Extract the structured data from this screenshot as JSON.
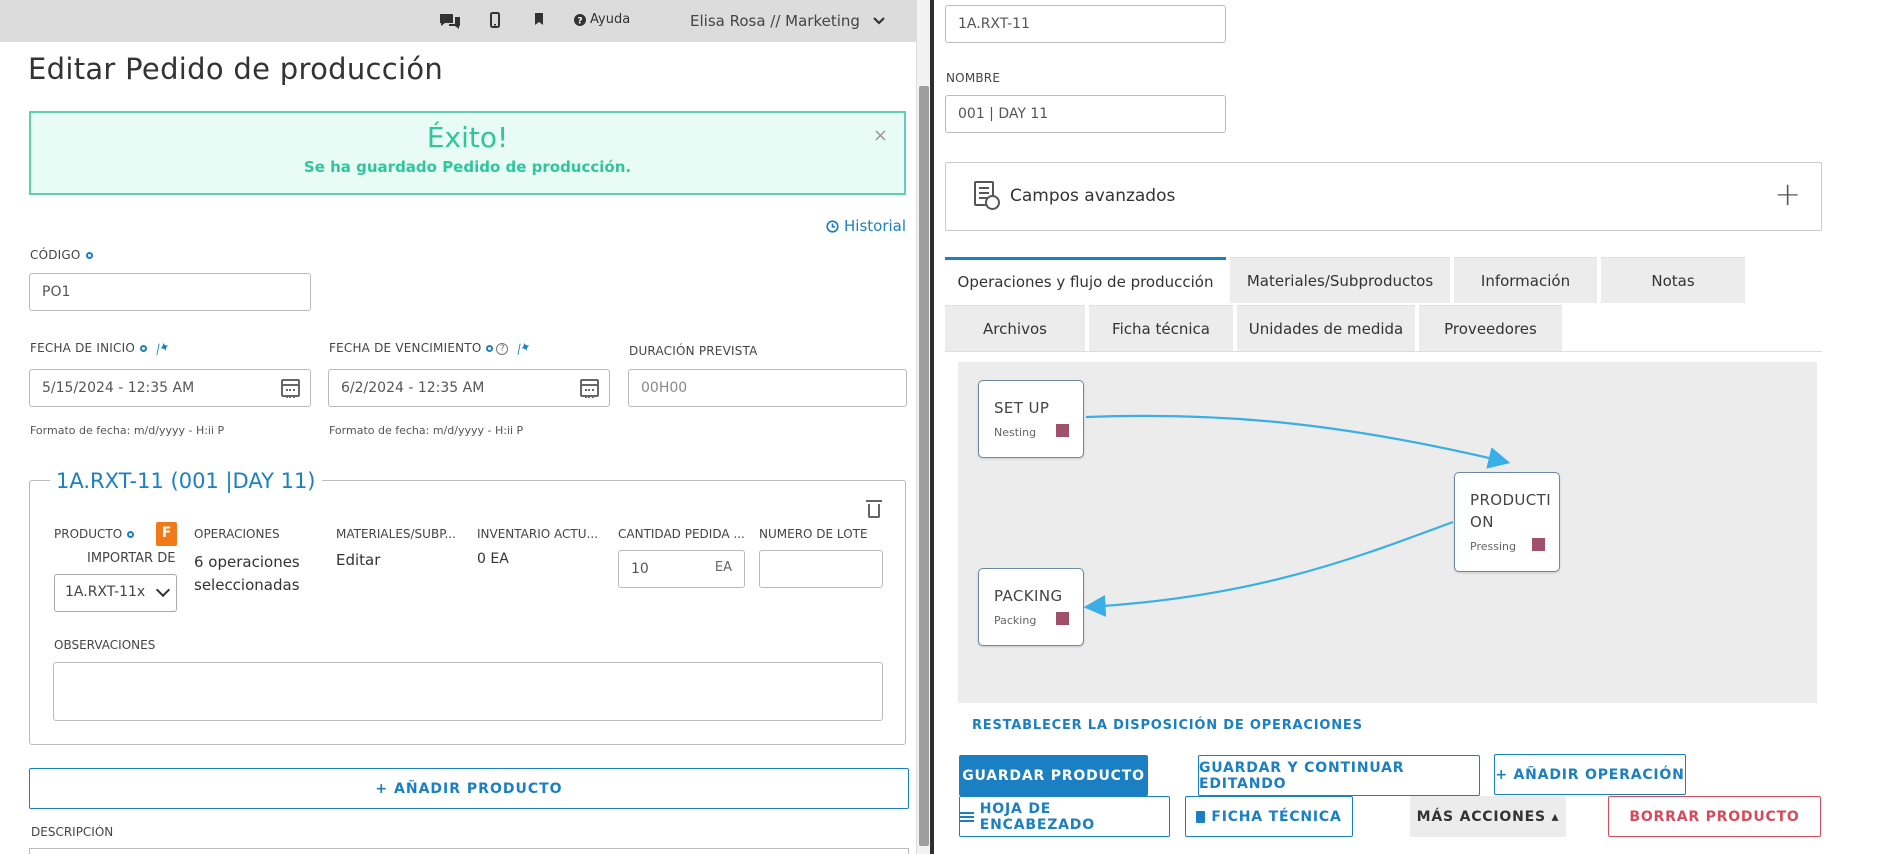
{
  "topbar": {
    "help_label": "Ayuda",
    "user_label": "Elisa Rosa // Marketing"
  },
  "page": {
    "title": "Editar Pedido de producción"
  },
  "alert": {
    "heading": "Éxito!",
    "message": "Se ha guardado Pedido de producción.",
    "close": "×"
  },
  "history_link": "Historial",
  "form": {
    "code_label": "CÓDIGO",
    "code_value": "PO1",
    "start_label": "FECHA DE INICIO",
    "start_value": "5/15/2024 - 12:35 AM",
    "start_hint": "Formato de fecha: m/d/yyyy - H:ii P",
    "due_label": "FECHA DE VENCIMIENTO",
    "due_value": "6/2/2024 - 12:35 AM",
    "due_hint": "Formato de fecha: m/d/yyyy - H:ii P",
    "duration_label": "DURACIÓN PREVISTA",
    "duration_placeholder": "00H00"
  },
  "product_block": {
    "legend": "1A.RXT-11 (001 |DAY 11)",
    "product_label": "PRODUCTO",
    "import_label": "IMPORTAR DE",
    "product_select": "1A.RXT-11x",
    "operations_label": "OPERACIONES",
    "operations_value": "6 operaciones seleccionadas",
    "materials_label": "MATERIALES/SUBP...",
    "materials_value": "Editar",
    "inventory_label": "INVENTARIO ACTU...",
    "inventory_value": "0 EA",
    "qty_label": "CANTIDAD PEDIDA ...",
    "qty_value": "10",
    "qty_unit": "EA",
    "lot_label": "NUMERO DE LOTE",
    "obs_label": "OBSERVACIONES",
    "file_icon_letter": "F"
  },
  "add_product_label": "+ AÑADIR PRODUCTO",
  "description_label": "DESCRIPCIÓN",
  "right": {
    "code_value": "1A.RXT-11",
    "name_label": "NOMBRE",
    "name_value": "001 | DAY 11",
    "advanced_title": "Campos avanzados",
    "advanced_plus": "+",
    "tabs": [
      {
        "label": "Operaciones y flujo de producción",
        "active": true
      },
      {
        "label": "Materiales/Subproductos",
        "active": false
      },
      {
        "label": "Información",
        "active": false
      },
      {
        "label": "Notas",
        "active": false
      },
      {
        "label": "Archivos",
        "active": false
      },
      {
        "label": "Ficha técnica",
        "active": false
      },
      {
        "label": "Unidades de medida",
        "active": false
      },
      {
        "label": "Proveedores",
        "active": false
      }
    ],
    "nodes": [
      {
        "title": "SET UP",
        "subtitle": "Nesting",
        "color": "#a0506a"
      },
      {
        "title": "PRODUCTI ON",
        "subtitle": "Pressing",
        "color": "#a0506a"
      },
      {
        "title": "PACKING",
        "subtitle": "Packing",
        "color": "#a0506a"
      }
    ],
    "reset_label": "RESTABLECER LA DISPOSICIÓN DE OPERACIONES",
    "buttons": {
      "save": "GUARDAR PRODUCTO",
      "save_continue": "GUARDAR Y CONTINUAR EDITANDO",
      "add_operation": "+ AÑADIR OPERACIÓN",
      "header_sheet": "HOJA DE ENCABEZADO",
      "tech_sheet": "FICHA TÉCNICA",
      "more_actions": "MÁS ACCIONES ▴",
      "delete": "BORRAR PRODUCTO"
    }
  },
  "colors": {
    "accent": "#1a7fc3",
    "success": "#2fc69a",
    "danger": "#d84a5a",
    "edge": "#3aaee6"
  }
}
